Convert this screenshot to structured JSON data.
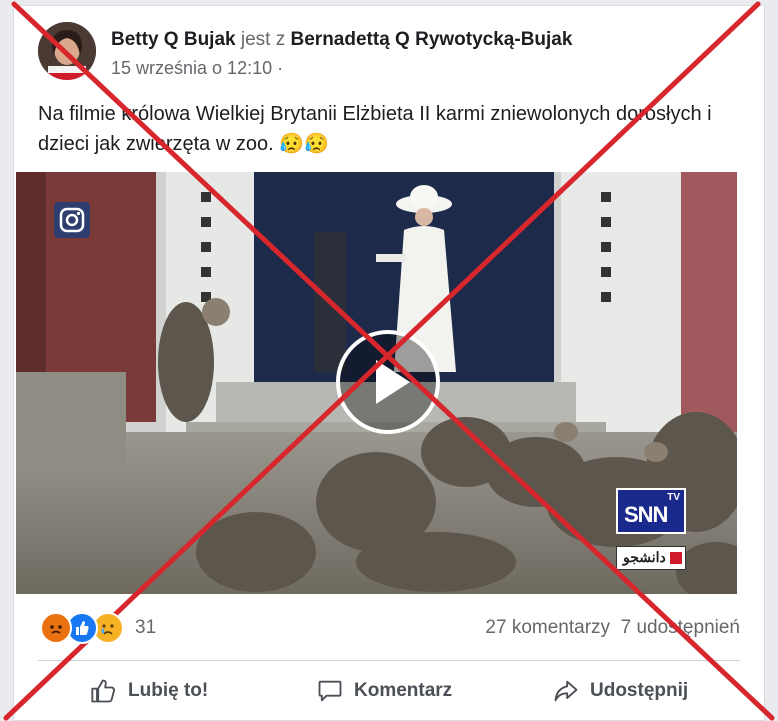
{
  "post": {
    "author": "Betty Q Bujak",
    "with_text": "jest z",
    "tagged": "Bernadettą Q Rywotycką-Bujak",
    "date": "15 września o 12:10",
    "separator": "·",
    "text": "Na filmie królowa Wielkiej Brytanii Elżbieta II karmi zniewolonych dorosłych i dzieci jak zwierzęta w zoo.",
    "text_emoji": "😥😥"
  },
  "video": {
    "watermark_logo": "SNN",
    "watermark_tv": "TV",
    "watermark_sub": "دانشجو"
  },
  "reactions": {
    "icons": [
      "angry-icon",
      "like-icon",
      "sad-icon"
    ],
    "count": "31",
    "comments": "27 komentarzy",
    "shares": "7 udostępnień"
  },
  "actions": {
    "like": "Lubię to!",
    "comment": "Komentarz",
    "share": "Udostępnij"
  },
  "colors": {
    "cross": "#d7262c",
    "like_blue": "#1877f2",
    "angry": "#f25268",
    "snn_blue": "#1a2a8c"
  }
}
